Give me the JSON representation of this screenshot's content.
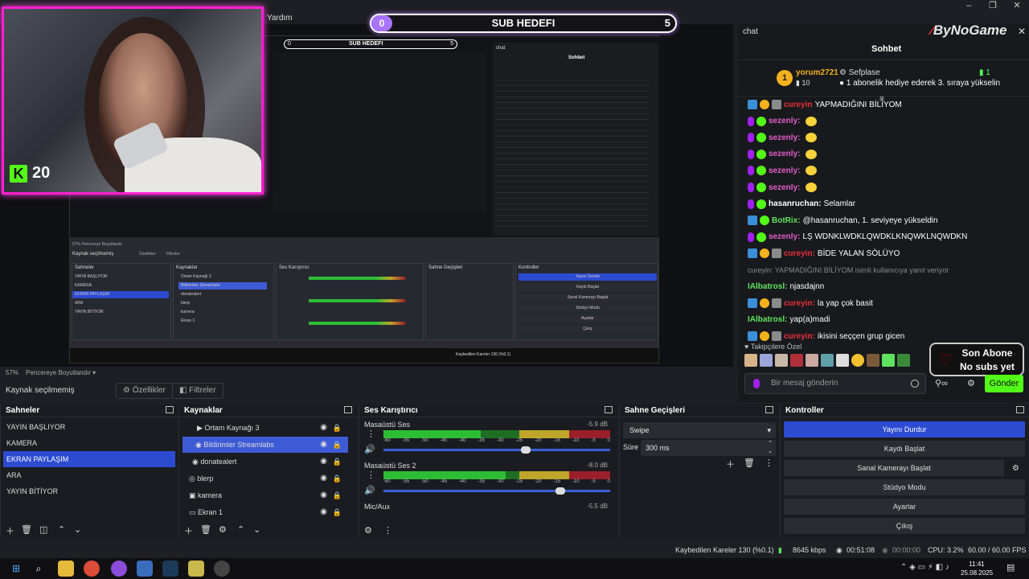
{
  "window": {
    "menu": "Yardım"
  },
  "subgoal": {
    "left": "0",
    "title": "SUB HEDEFI",
    "right": "5"
  },
  "webcam": {
    "kick_count": "20"
  },
  "nested": {
    "sub_left": "0",
    "sub_title": "SUB HEDEFI",
    "sub_right": "5",
    "sohbet": "Sohbet",
    "chat": "chat",
    "zoom": "57%",
    "fit": "Pencereye Boyutlandır",
    "source": "Kaynak seçilmemiş",
    "props": "Özellikler",
    "filters": "Filtreler",
    "scenes_title": "Sahneler",
    "sources_title": "Kaynaklar",
    "mixer_title": "Ses Karıştırıcı",
    "trans_title": "Sahne Geçişleri",
    "ctl_title": "Kontroller",
    "scenes": [
      "YAYIN BAŞLIYOR",
      "KAMERA",
      "EKRAN PAYLAŞIM",
      "ARA",
      "YAYIN BİTİYOR"
    ],
    "sources": [
      "Ortam Kaynağı 3",
      "Bildirimler Streamlabs",
      "donatealert",
      "blerp",
      "kamera",
      "Ekran 1"
    ],
    "ctl": [
      "Yayını Durdur",
      "Kaydı Başlat",
      "Sanal Kamerayı Başlat",
      "Stüdyo Modu",
      "Ayarlar",
      "Çıkış"
    ],
    "status": "Kaybedilen Kareler 130 (%0.1)"
  },
  "chat": {
    "title": "chat",
    "logo_prefix": "By",
    "logo_name": "NoGame",
    "header": "Sohbet",
    "pinned": {
      "rank": "1",
      "user": "yorum2721",
      "count": "10",
      "sender": "Sefplase",
      "amount": "1",
      "message": "1 abonelik hediye ederek 3. sıraya yükselin"
    },
    "messages": [
      {
        "name": "cureyin",
        "text": "YAPMADIĞINI BİLİYOM",
        "color": "red"
      },
      {
        "name": "sezenly:",
        "text": "",
        "color": "pink"
      },
      {
        "name": "sezenly:",
        "text": "",
        "color": "pink"
      },
      {
        "name": "sezenly:",
        "text": "",
        "color": "pink"
      },
      {
        "name": "sezenly:",
        "text": "",
        "color": "pink"
      },
      {
        "name": "sezenly:",
        "text": "",
        "color": "pink"
      },
      {
        "name": "hasanruchan:",
        "text": "Selamlar",
        "color": "pink"
      },
      {
        "name": "BotRix:",
        "text": "@hasanruchan, 1. seviyeye yükseldin",
        "color": "green"
      },
      {
        "name": "sezenly:",
        "text": "LŞ WDNKLWDKLQWDKLKNQWKLNQWDKN",
        "color": "pink"
      },
      {
        "name": "cureyin:",
        "text": "BİDE YALAN SÖLÜYO",
        "color": "red"
      },
      {
        "name": "",
        "text": "cureyin: YAPMADIĞINI BİLİYOM isimli kullanıcıya yanıt veriyor",
        "color": "reply"
      },
      {
        "name": "IAlbatrosl:",
        "text": "njasdajnn",
        "color": "green"
      },
      {
        "name": "cureyin:",
        "text": "la yap çok basit",
        "color": "red"
      },
      {
        "name": "IAlbatrosl:",
        "text": "yap(a)madi",
        "color": "green"
      },
      {
        "name": "cureyin:",
        "text": "ikisini seççen grup gicen",
        "color": "red"
      }
    ],
    "followers_label": "Takipçilere Özel",
    "son_abone": "Son Abone",
    "no_subs": "No subs yet",
    "placeholder": "Bir mesaj gönderin",
    "send": "Gönder"
  },
  "preview_bar": {
    "zoom": "57%",
    "fit": "Pencereye Boyutlandır"
  },
  "source_bar": {
    "none": "Kaynak seçilmemiş",
    "props": "Özellikler",
    "filters": "Filtreler"
  },
  "scenes": {
    "title": "Sahneler",
    "items": [
      "YAYIN BAŞLIYOR",
      "KAMERA",
      "EKRAN PAYLAŞIM",
      "ARA",
      "YAYIN BİTİYOR"
    ],
    "selected": 2
  },
  "sources": {
    "title": "Kaynaklar",
    "items": [
      "Ortam Kaynağı 3",
      "Bildirimler Streamlabs",
      "donatealert",
      "blerp",
      "kamera",
      "Ekran 1"
    ],
    "selected": 1
  },
  "mixer": {
    "title": "Ses Karıştırıcı",
    "channels": [
      {
        "name": "Masaüstü Ses",
        "db": "-5.9 dB",
        "level": 0.55
      },
      {
        "name": "Masaüstü Ses 2",
        "db": "-8.0 dB",
        "level": 0.69
      },
      {
        "name": "Mic/Aux",
        "db": "-5.5 dB",
        "level": 0.5
      }
    ],
    "scale": [
      "-60",
      "-55",
      "-50",
      "-45",
      "-40",
      "-35",
      "-30",
      "-25",
      "-20",
      "-15",
      "-10",
      "-5",
      "0"
    ]
  },
  "transitions": {
    "title": "Sahne Geçişleri",
    "type": "Swipe",
    "duration_label": "Süre",
    "duration": "300 ms"
  },
  "controls": {
    "title": "Kontroller",
    "buttons": [
      "Yayını Durdur",
      "Kaydı Başlat",
      "Sanal Kamerayı Başlat",
      "Stüdyo Modu",
      "Ayarlar",
      "Çıkış"
    ]
  },
  "status": {
    "dropped": "Kaybedilen Kareler 130 (%0.1)",
    "bitrate": "8645 kbps",
    "stream_time": "00:51:08",
    "rec_time": "00:00:00",
    "cpu": "CPU: 3.2%",
    "fps": "60.00 / 60.00 FPS"
  },
  "taskbar": {
    "time": "11:41",
    "date": "25.08.2025"
  }
}
